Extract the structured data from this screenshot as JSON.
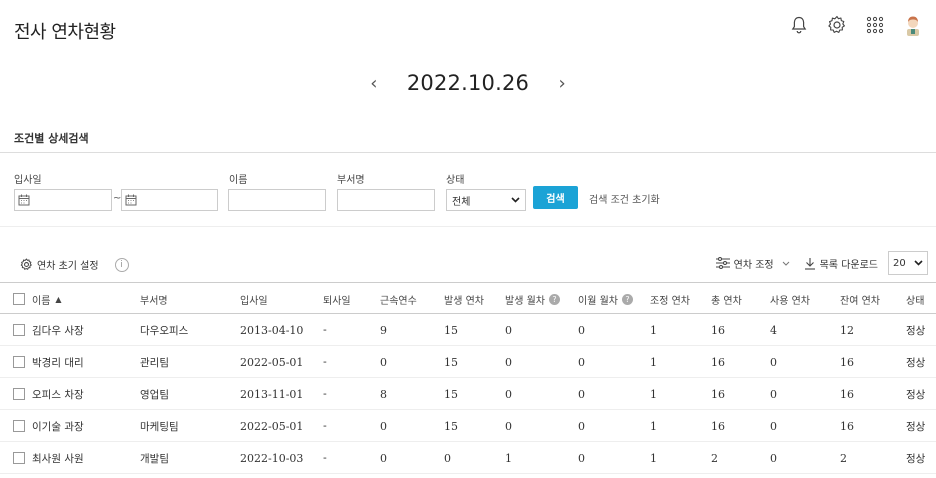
{
  "header": {
    "title": "전사 연차현황",
    "icons": [
      "bell-icon",
      "gear-icon",
      "apps-grid-icon",
      "avatar"
    ]
  },
  "date_nav": {
    "prev": "‹",
    "date": "2022.10.26",
    "next": "›"
  },
  "search": {
    "section_title": "조건별 상세검색",
    "hire_date_label": "입사일",
    "range_sep": "~",
    "name_label": "이름",
    "dept_label": "부서명",
    "status_label": "상태",
    "status_selected": "전체",
    "search_button": "검색",
    "reset_link": "검색 조건 초기화"
  },
  "toolbar": {
    "init_settings": "연차 초기 설정",
    "adjust": "연차 조정",
    "download": "목록 다운로드",
    "page_size": "20"
  },
  "table": {
    "headers": {
      "name": "이름",
      "sort_indicator": "▲",
      "dept": "부서명",
      "hire_date": "입사일",
      "leave_date": "퇴사일",
      "years": "근속연수",
      "generated": "발생 연차",
      "generated_monthly": "발생 월차",
      "carried_monthly": "이월 월차",
      "adjusted": "조정 연차",
      "total": "총 연차",
      "used": "사용 연차",
      "remaining": "잔여 연차",
      "status": "상태"
    },
    "rows": [
      {
        "name": "김다우 사장",
        "dept": "다우오피스",
        "hire": "2013-04-10",
        "leave": "-",
        "years": "9",
        "gen": "15",
        "gen_m": "0",
        "carry_m": "0",
        "adj": "1",
        "total": "16",
        "used": "4",
        "remain": "12",
        "status": "정상"
      },
      {
        "name": "박경리 대리",
        "dept": "관리팀",
        "hire": "2022-05-01",
        "leave": "-",
        "years": "0",
        "gen": "15",
        "gen_m": "0",
        "carry_m": "0",
        "adj": "1",
        "total": "16",
        "used": "0",
        "remain": "16",
        "status": "정상"
      },
      {
        "name": "오피스 차장",
        "dept": "영업팀",
        "hire": "2013-11-01",
        "leave": "-",
        "years": "8",
        "gen": "15",
        "gen_m": "0",
        "carry_m": "0",
        "adj": "1",
        "total": "16",
        "used": "0",
        "remain": "16",
        "status": "정상"
      },
      {
        "name": "이기술 과장",
        "dept": "마케팅팀",
        "hire": "2022-05-01",
        "leave": "-",
        "years": "0",
        "gen": "15",
        "gen_m": "0",
        "carry_m": "0",
        "adj": "1",
        "total": "16",
        "used": "0",
        "remain": "16",
        "status": "정상"
      },
      {
        "name": "최사원 사원",
        "dept": "개발팀",
        "hire": "2022-10-03",
        "leave": "-",
        "years": "0",
        "gen": "0",
        "gen_m": "1",
        "carry_m": "0",
        "adj": "1",
        "total": "2",
        "used": "0",
        "remain": "2",
        "status": "정상"
      }
    ]
  }
}
